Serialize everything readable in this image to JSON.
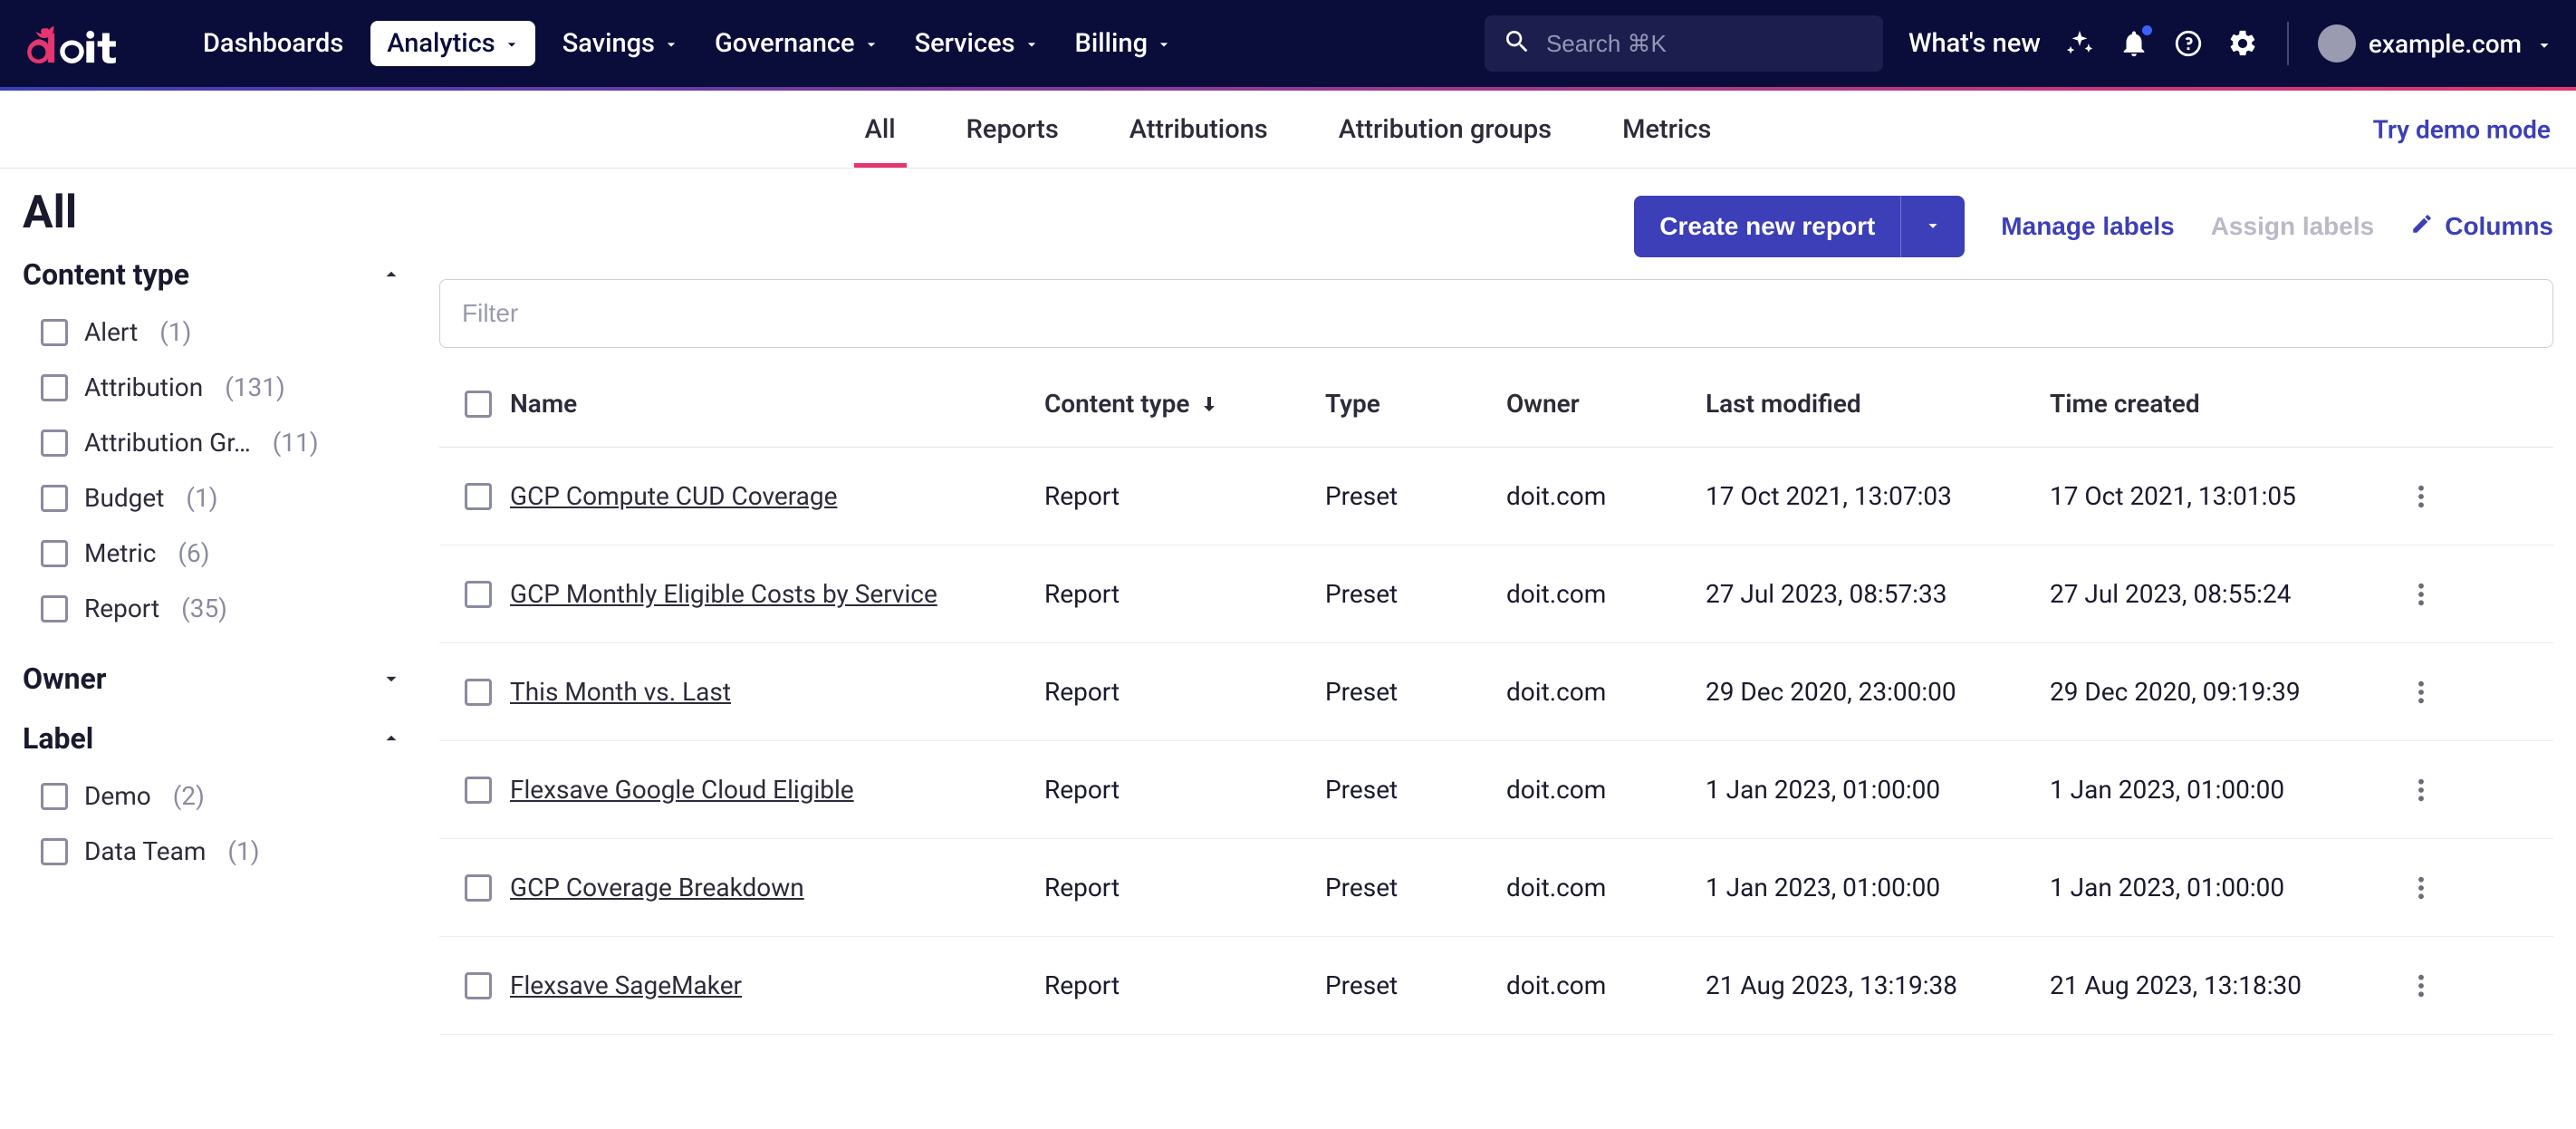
{
  "topnav": {
    "items": [
      {
        "label": "Dashboards",
        "has_chevron": false
      },
      {
        "label": "Analytics",
        "has_chevron": true,
        "active": true
      },
      {
        "label": "Savings",
        "has_chevron": true
      },
      {
        "label": "Governance",
        "has_chevron": true
      },
      {
        "label": "Services",
        "has_chevron": true
      },
      {
        "label": "Billing",
        "has_chevron": true
      }
    ],
    "search_placeholder": "Search ⌘K",
    "whats_new": "What's new",
    "account": "example.com"
  },
  "subtabs": {
    "items": [
      "All",
      "Reports",
      "Attributions",
      "Attribution groups",
      "Metrics"
    ],
    "active_index": 0,
    "demo": "Try demo mode"
  },
  "page": {
    "title": "All"
  },
  "actions": {
    "create": "Create new report",
    "manage_labels": "Manage labels",
    "assign_labels": "Assign labels",
    "columns": "Columns"
  },
  "filter_input": {
    "placeholder": "Filter"
  },
  "facets": {
    "content_type": {
      "title": "Content type",
      "expanded": true,
      "items": [
        {
          "label": "Alert",
          "count": "(1)"
        },
        {
          "label": "Attribution",
          "count": "(131)"
        },
        {
          "label": "Attribution Group",
          "count": "(11)",
          "truncate": true
        },
        {
          "label": "Budget",
          "count": "(1)"
        },
        {
          "label": "Metric",
          "count": "(6)"
        },
        {
          "label": "Report",
          "count": "(35)"
        }
      ]
    },
    "owner": {
      "title": "Owner",
      "expanded": false
    },
    "label": {
      "title": "Label",
      "expanded": true,
      "items": [
        {
          "label": "Demo",
          "count": "(2)"
        },
        {
          "label": "Data Team",
          "count": "(1)"
        }
      ]
    }
  },
  "table": {
    "columns": [
      "Name",
      "Content type",
      "Type",
      "Owner",
      "Last modified",
      "Time created"
    ],
    "sort_column_index": 1,
    "rows": [
      {
        "name": "GCP Compute CUD Coverage",
        "content_type": "Report",
        "type": "Preset",
        "owner": "doit.com",
        "last_modified": "17 Oct 2021, 13:07:03",
        "time_created": "17 Oct 2021, 13:01:05"
      },
      {
        "name": "GCP Monthly Eligible Costs by Service",
        "content_type": "Report",
        "type": "Preset",
        "owner": "doit.com",
        "last_modified": "27 Jul 2023, 08:57:33",
        "time_created": "27 Jul 2023, 08:55:24"
      },
      {
        "name": "This Month vs. Last",
        "content_type": "Report",
        "type": "Preset",
        "owner": "doit.com",
        "last_modified": "29 Dec 2020, 23:00:00",
        "time_created": "29 Dec 2020, 09:19:39"
      },
      {
        "name": "Flexsave Google Cloud Eligible",
        "content_type": "Report",
        "type": "Preset",
        "owner": "doit.com",
        "last_modified": "1 Jan 2023, 01:00:00",
        "time_created": "1 Jan 2023, 01:00:00"
      },
      {
        "name": "GCP Coverage Breakdown",
        "content_type": "Report",
        "type": "Preset",
        "owner": "doit.com",
        "last_modified": "1 Jan 2023, 01:00:00",
        "time_created": "1 Jan 2023, 01:00:00"
      },
      {
        "name": "Flexsave SageMaker",
        "content_type": "Report",
        "type": "Preset",
        "owner": "doit.com",
        "last_modified": "21 Aug 2023, 13:19:38",
        "time_created": "21 Aug 2023, 13:18:30"
      }
    ]
  }
}
